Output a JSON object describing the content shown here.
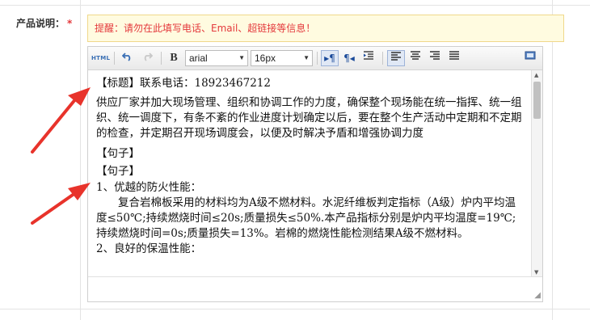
{
  "field": {
    "label": "产品说明：",
    "required_mark": "*"
  },
  "notice": {
    "text": "提醒：请勿在此填写电话、Email、超链接等信息！"
  },
  "toolbar": {
    "html_label": "HTML",
    "bold_label": "B",
    "font_family": "arial",
    "font_size": "16px"
  },
  "content": {
    "lines": [
      "【标题】联系电话：18923467212",
      "供应厂家并加大现场管理、组织和协调工作的力度，确保整个现场能在统一指挥、统一组织、统一调度下，有条不紊的作业进度计划确定以后，要在整个生产活动中定期和不定期的检查，并定期召开现场调度会，以便及时解决予盾和增强协调力度",
      "【句子】",
      "【句子】",
      "1、优越的防火性能：",
      "　　复合岩棉板采用的材料均为A级不燃材料。水泥纤维板判定指标（A级）炉内平均温度≤50℃;持续燃烧时间≤20s;质量损失≤50%.本产品指标分别是炉内平均温度=19℃;持续燃烧时间=0s;质量损失=13%。岩棉的燃烧性能检测结果A级不燃材料。",
      "2、良好的保温性能："
    ]
  },
  "colors": {
    "notice_text": "#e4393c",
    "arrow": "#e8332b",
    "required": "#e4393c"
  }
}
